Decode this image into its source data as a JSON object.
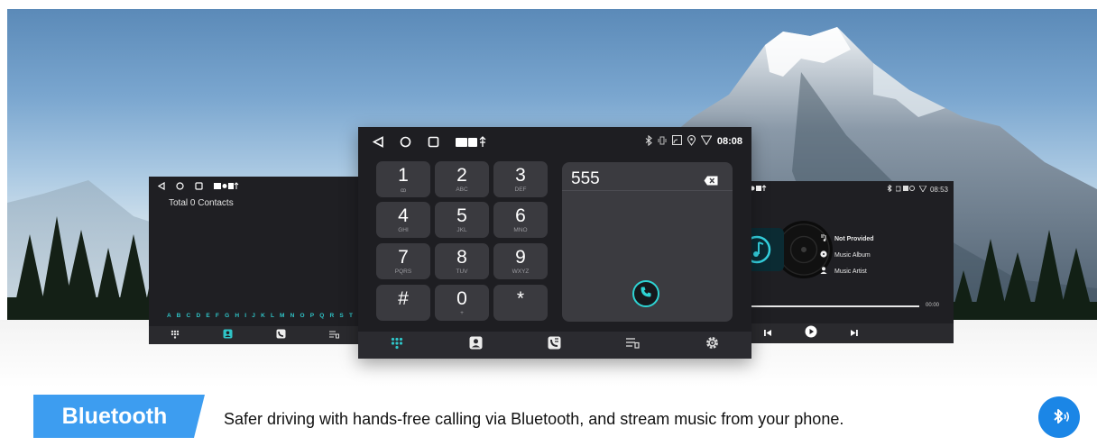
{
  "left_screen": {
    "contacts_total": "Total 0 Contacts",
    "alphabet": "A B C D E F G H I J K L M N O P Q R S T"
  },
  "dialer": {
    "time": "08:08",
    "number": "555",
    "keys": [
      {
        "digit": "1",
        "sub": "ꝏ"
      },
      {
        "digit": "2",
        "sub": "ABC"
      },
      {
        "digit": "3",
        "sub": "DEF"
      },
      {
        "digit": "4",
        "sub": "GHI"
      },
      {
        "digit": "5",
        "sub": "JKL"
      },
      {
        "digit": "6",
        "sub": "MNO"
      },
      {
        "digit": "7",
        "sub": "PQRS"
      },
      {
        "digit": "8",
        "sub": "TUV"
      },
      {
        "digit": "9",
        "sub": "WXYZ"
      },
      {
        "digit": "#",
        "sub": ""
      },
      {
        "digit": "0",
        "sub": "+"
      },
      {
        "digit": "*",
        "sub": ""
      }
    ]
  },
  "music": {
    "time": "08:53",
    "title": "Not Provided",
    "album": "Music Album",
    "artist": "Music Artist",
    "position": "00:00"
  },
  "footer": {
    "badge": "Bluetooth",
    "tagline": "Safer driving with hands-free calling via Bluetooth, and stream music from your phone."
  },
  "colors": {
    "accent": "#2fc4c7",
    "badge_blue": "#3d9df0",
    "bt_icon": "#1b86e6"
  },
  "icons": [
    "dialpad-icon",
    "contacts-icon",
    "call-log-icon",
    "playlist-icon",
    "settings-icon",
    "bluetooth-icon",
    "call-icon",
    "backspace-icon"
  ]
}
